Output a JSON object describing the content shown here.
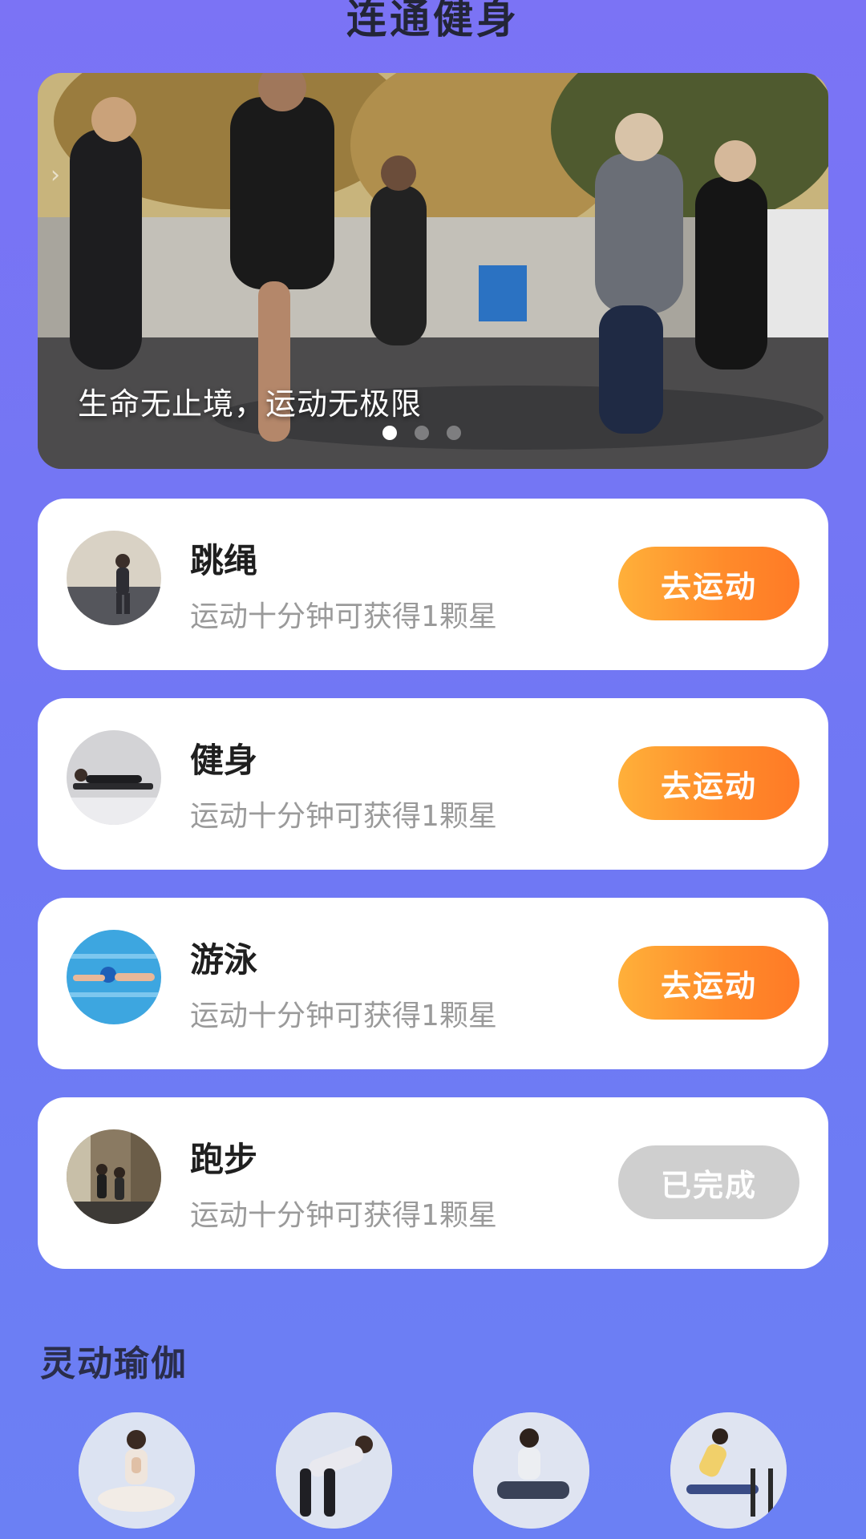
{
  "header": {
    "title": "连通健身"
  },
  "banner": {
    "caption": "生命无止境，运动无极限",
    "slide_count": 3,
    "active_slide": 1
  },
  "activities": [
    {
      "name": "跳绳",
      "desc": "运动十分钟可获得1颗星",
      "button": "去运动",
      "status": "todo",
      "icon": "jump-rope-photo"
    },
    {
      "name": "健身",
      "desc": "运动十分钟可获得1颗星",
      "button": "去运动",
      "status": "todo",
      "icon": "plank-photo"
    },
    {
      "name": "游泳",
      "desc": "运动十分钟可获得1颗星",
      "button": "去运动",
      "status": "todo",
      "icon": "swimming-photo"
    },
    {
      "name": "跑步",
      "desc": "运动十分钟可获得1颗星",
      "button": "已完成",
      "status": "done",
      "icon": "running-photo"
    }
  ],
  "yoga": {
    "title": "灵动瑜伽",
    "items": [
      "yoga-meditation-photo",
      "yoga-bend-photo",
      "yoga-seated-photo",
      "yoga-chair-photo"
    ]
  },
  "colors": {
    "background": "#7473F5",
    "accent_orange": "#FF8A2A",
    "done_gray": "#CFCFCF"
  }
}
